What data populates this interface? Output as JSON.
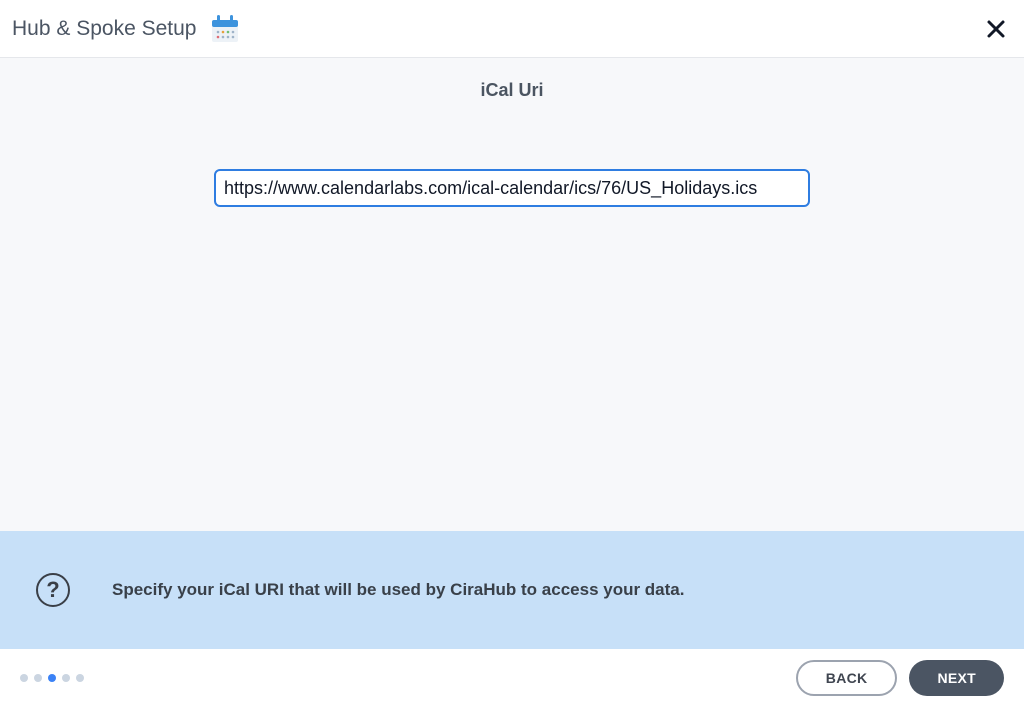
{
  "header": {
    "title": "Hub & Spoke Setup"
  },
  "main": {
    "field_label": "iCal Uri",
    "url_value": "https://www.calendarlabs.com/ical-calendar/ics/76/US_Holidays.ics"
  },
  "help": {
    "icon_char": "?",
    "text": "Specify your iCal URI that will be used by CiraHub to access your data."
  },
  "footer": {
    "back_label": "BACK",
    "next_label": "NEXT",
    "progress_total": 5,
    "progress_current": 3
  }
}
